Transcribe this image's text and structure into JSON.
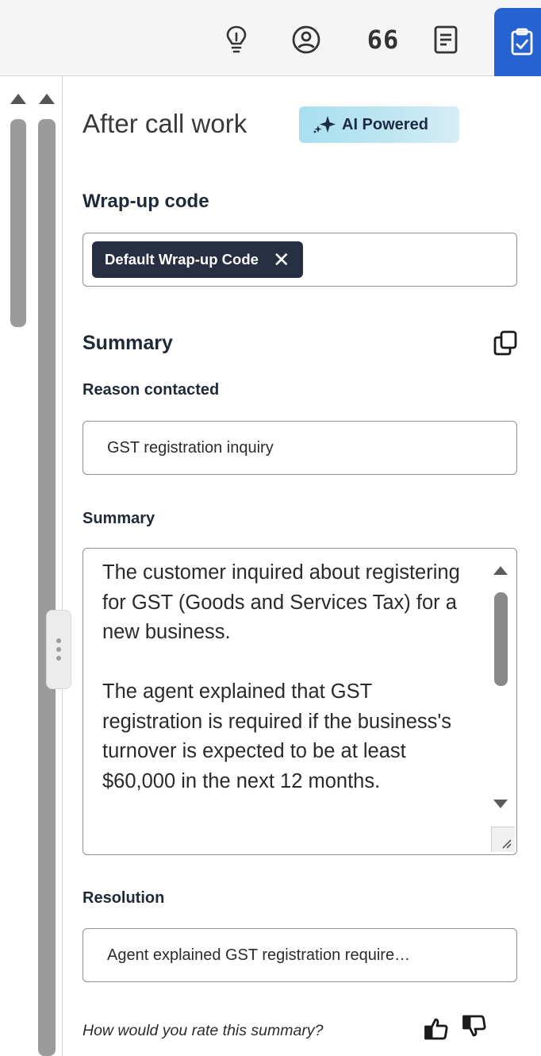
{
  "toolbar": {
    "icons": [
      "lightbulb-icon",
      "user-circle-icon",
      "quote-icon",
      "document-icon",
      "clipboard-check-icon"
    ],
    "quote_glyph": "66",
    "active_color": "#2563d1"
  },
  "panel": {
    "title": "After call work",
    "ai_badge": "AI Powered",
    "wrap_up": {
      "label": "Wrap-up code",
      "chip": "Default Wrap-up Code"
    },
    "summary_section": {
      "label": "Summary",
      "reason": {
        "label": "Reason contacted",
        "value": "GST registration inquiry"
      },
      "summary": {
        "label": "Summary",
        "value": "The customer inquired about registering for GST (Goods and Services Tax) for a new business.\n\nThe agent explained that GST registration is required if the business's turnover is expected to be at least $60,000 in the next 12 months."
      },
      "resolution": {
        "label": "Resolution",
        "value": "Agent explained GST registration require…"
      }
    },
    "rating": {
      "question": "How would you rate this summary?"
    }
  },
  "colors": {
    "chip_bg": "#263042",
    "ai_badge_bg": "#bfe6f2",
    "primary": "#2563d1"
  }
}
